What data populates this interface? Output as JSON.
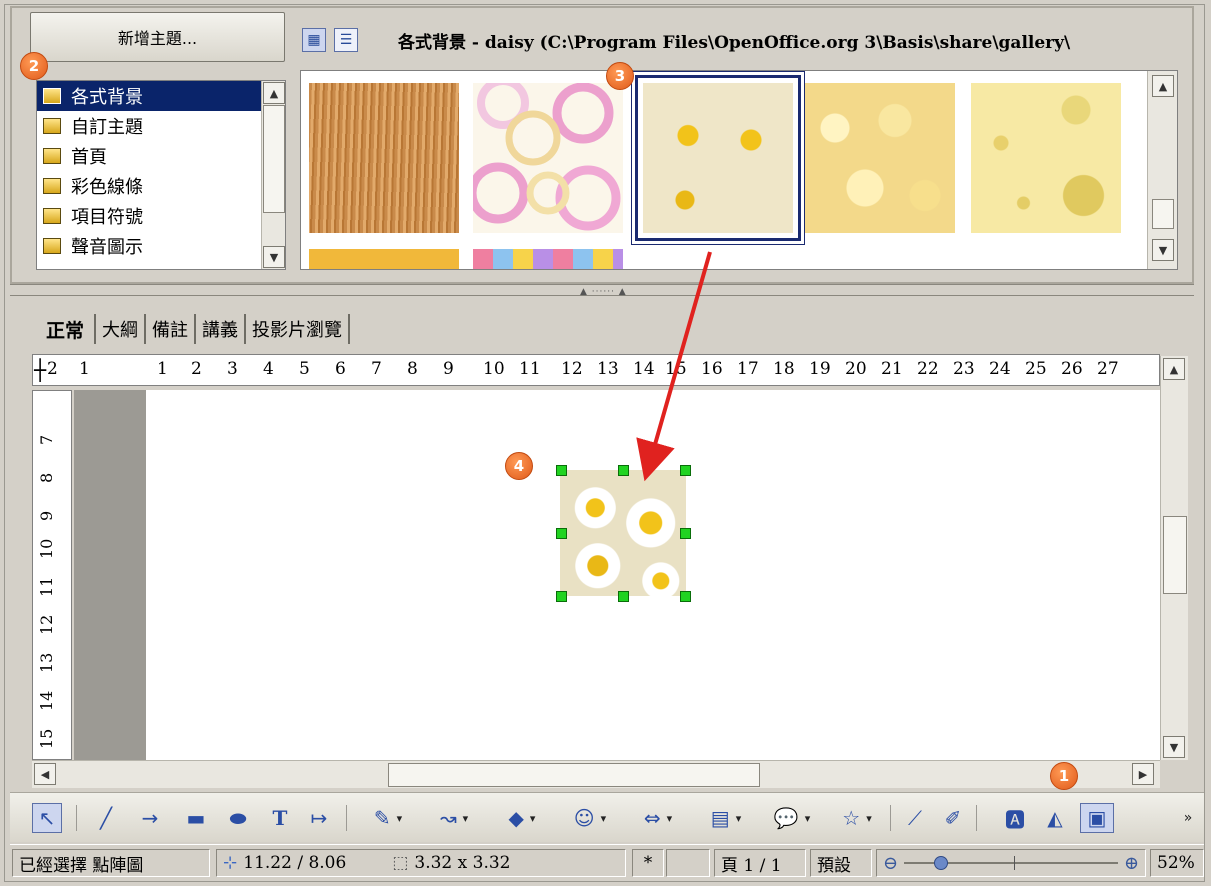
{
  "gallery": {
    "new_theme_button": "新增主題...",
    "path_title": "各式背景 - daisy (C:\\Program Files\\OpenOffice.org 3\\Basis\\share\\gallery\\",
    "themes": [
      "各式背景",
      "自訂主題",
      "首頁",
      "彩色線條",
      "項目符號",
      "聲音圖示"
    ],
    "selected_theme": "各式背景",
    "thumbnails": [
      "wood",
      "circles",
      "daisy",
      "popcorn",
      "cheese"
    ],
    "selected_thumbnail": "daisy"
  },
  "tabs": [
    "正常",
    "大綱",
    "備註",
    "講義",
    "投影片瀏覽"
  ],
  "active_tab": "正常",
  "ruler": {
    "horizontal": [
      "2",
      "1",
      "1",
      "2",
      "3",
      "4",
      "5",
      "6",
      "7",
      "8",
      "9",
      "10",
      "11",
      "12",
      "13",
      "14",
      "15",
      "16",
      "17",
      "18",
      "19",
      "20",
      "21",
      "22",
      "23",
      "24",
      "25",
      "26",
      "27"
    ],
    "vertical": [
      "7",
      "8",
      "9",
      "10",
      "11",
      "12",
      "13",
      "14",
      "15"
    ]
  },
  "badges": {
    "b1": "1",
    "b2": "2",
    "b3": "3",
    "b4": "4"
  },
  "statusbar": {
    "selection": "已經選擇 點陣圖",
    "position": "11.22 / 8.06",
    "size": "3.32 x 3.32",
    "modified": "*",
    "page": "頁 1 / 1",
    "layout": "預設",
    "zoom": "52%"
  },
  "colors": {
    "accent": "#0a246a",
    "badge": "#e8641f",
    "handle": "#21d321",
    "arrow": "#e0221f"
  }
}
